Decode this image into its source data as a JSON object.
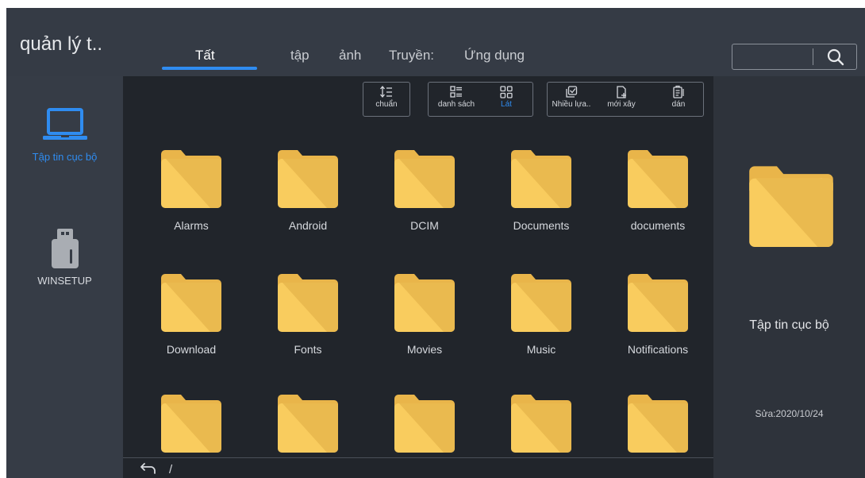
{
  "app": {
    "title": "quản lý t.."
  },
  "tabs": [
    {
      "label": "Tất",
      "active": true
    },
    {
      "label": "tập"
    },
    {
      "label": "ảnh"
    },
    {
      "label": "Truyền:"
    },
    {
      "label": "Ứng dụng"
    }
  ],
  "search": {
    "placeholder": "",
    "icon": "search-icon"
  },
  "sidebar": {
    "items": [
      {
        "label": "Tập tin cục bộ",
        "icon": "laptop-icon",
        "active": true
      },
      {
        "label": "WINSETUP",
        "icon": "usb-drive-icon"
      }
    ]
  },
  "toolbar": {
    "sort": {
      "label": "chuẩn",
      "icon": "sort-icon"
    },
    "list": {
      "label": "danh sách",
      "icon": "list-view-icon"
    },
    "tile": {
      "label": "Lát",
      "icon": "grid-view-icon",
      "active": true
    },
    "multi": {
      "label": "Nhiều lựa..",
      "icon": "multi-select-icon"
    },
    "new": {
      "label": "mới xây",
      "icon": "new-file-icon"
    },
    "paste": {
      "label": "dán",
      "icon": "paste-icon"
    }
  },
  "folders": [
    {
      "name": "Alarms"
    },
    {
      "name": "Android"
    },
    {
      "name": "DCIM"
    },
    {
      "name": "Documents"
    },
    {
      "name": "documents"
    },
    {
      "name": "Download"
    },
    {
      "name": "Fonts"
    },
    {
      "name": "Movies"
    },
    {
      "name": "Music"
    },
    {
      "name": "Notifications"
    },
    {
      "name": ""
    },
    {
      "name": ""
    },
    {
      "name": ""
    },
    {
      "name": ""
    },
    {
      "name": ""
    }
  ],
  "path": {
    "current": "/",
    "back_icon": "back-arrow-icon"
  },
  "detail": {
    "name": "Tập tin cục bộ",
    "modified": "Sửa:2020/10/24"
  },
  "colors": {
    "accent": "#2f8cf0",
    "folder": "#f7c85a",
    "background": "#21252b"
  }
}
